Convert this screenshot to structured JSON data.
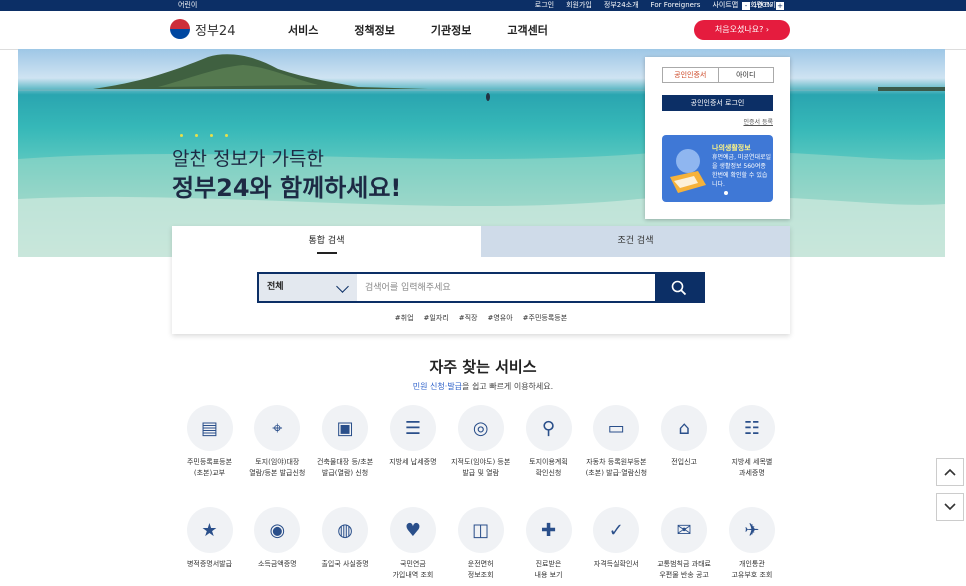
{
  "topbar": {
    "kids_label": "어린이",
    "links": [
      "로그인",
      "회원가입",
      "정부24소개",
      "For Foreigners",
      "사이트맵",
      "화면크기"
    ],
    "font_minus": "-",
    "zoom": "100%",
    "font_plus": "+"
  },
  "header": {
    "logo_text": "정부24",
    "menu": [
      "서비스",
      "정책정보",
      "기관정보",
      "고객센터"
    ],
    "first_visit_button": "처음오셨나요?"
  },
  "hero": {
    "line1": "알찬 정보가 가득한",
    "line2": "정부24와 함께하세요!"
  },
  "login_box": {
    "tabs": [
      "공인인증서",
      "아이디"
    ],
    "login_button": "공인인증서 로그인",
    "register_link": "인증서 등록",
    "banner_title": "나의생활정보",
    "banner_text": "휴먼예금, 미공연대로일을 생활정보 560여종 한번에 확인할 수 있습니다."
  },
  "search": {
    "tabs": [
      "통합 검색",
      "조건 검색"
    ],
    "category": "전체",
    "placeholder": "검색어를 입력해주세요",
    "tags": [
      "#취업",
      "#일자리",
      "#직장",
      "#영유아",
      "#주민등록등본"
    ]
  },
  "frequent": {
    "title": "자주 찾는 서비스",
    "subtitle_highlight": "민원 신청·발급",
    "subtitle_rest": "을 쉽고 빠르게 이용하세요.",
    "items": [
      {
        "icon": "id-card-icon",
        "label": "주민등록표등본\n(초본)교부"
      },
      {
        "icon": "laptop-map-icon",
        "label": "토지(임야)대장\n열람/등본 발급신청"
      },
      {
        "icon": "document-search-icon",
        "label": "건축물대장 등/초본\n발급(열람) 신청"
      },
      {
        "icon": "tax-document-icon",
        "label": "지방세 납세증명"
      },
      {
        "icon": "map-search-icon",
        "label": "지적도(임야도) 등본\n발급 및 열람"
      },
      {
        "icon": "map-pin-icon",
        "label": "토지이용계획\n확인신청"
      },
      {
        "icon": "car-document-icon",
        "label": "자동차 등록원부등본\n(초본) 발급·열람신청"
      },
      {
        "icon": "house-icon",
        "label": "전입신고"
      },
      {
        "icon": "tax-list-icon",
        "label": "지방세 세목별\n과세증명"
      },
      {
        "icon": "military-certificate-icon",
        "label": "병적증명서발급"
      },
      {
        "icon": "income-coins-icon",
        "label": "소득금액증명"
      },
      {
        "icon": "passport-icon",
        "label": "출입국 사실증명"
      },
      {
        "icon": "pension-monitor-icon",
        "label": "국민연금\n가입내역 조회"
      },
      {
        "icon": "driver-license-icon",
        "label": "운전면허\n정보조회"
      },
      {
        "icon": "medical-check-icon",
        "label": "진료받은\n내용 보기"
      },
      {
        "icon": "checklist-icon",
        "label": "자격득실확인서"
      },
      {
        "icon": "traffic-fine-icon",
        "label": "교통범칙금 과태료\n우편물 반송 공고"
      },
      {
        "icon": "customs-plane-icon",
        "label": "개인통관\n고유부호 조회"
      }
    ]
  },
  "side": {
    "up": "scroll-up-icon",
    "down": "scroll-down-icon"
  }
}
